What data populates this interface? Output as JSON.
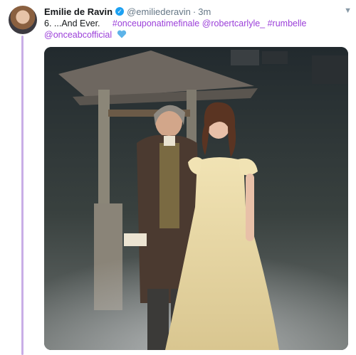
{
  "tweet": {
    "author_name": "Emilie de Ravin",
    "handle": "@emiliederavin",
    "separator": "·",
    "time": "3m",
    "text_plain": "6. ...And Ever.",
    "hashtags": [
      "#onceuponatimefinale",
      "@robertcarlyle_",
      "#rumbelle",
      "@onceabcofficial"
    ],
    "link_color": "#9b3fd9",
    "heart_color": "#5db3e8"
  },
  "icons": {
    "verified": "verified-badge-icon",
    "caret": "chevron-down-icon",
    "heart": "blue-heart-icon"
  }
}
